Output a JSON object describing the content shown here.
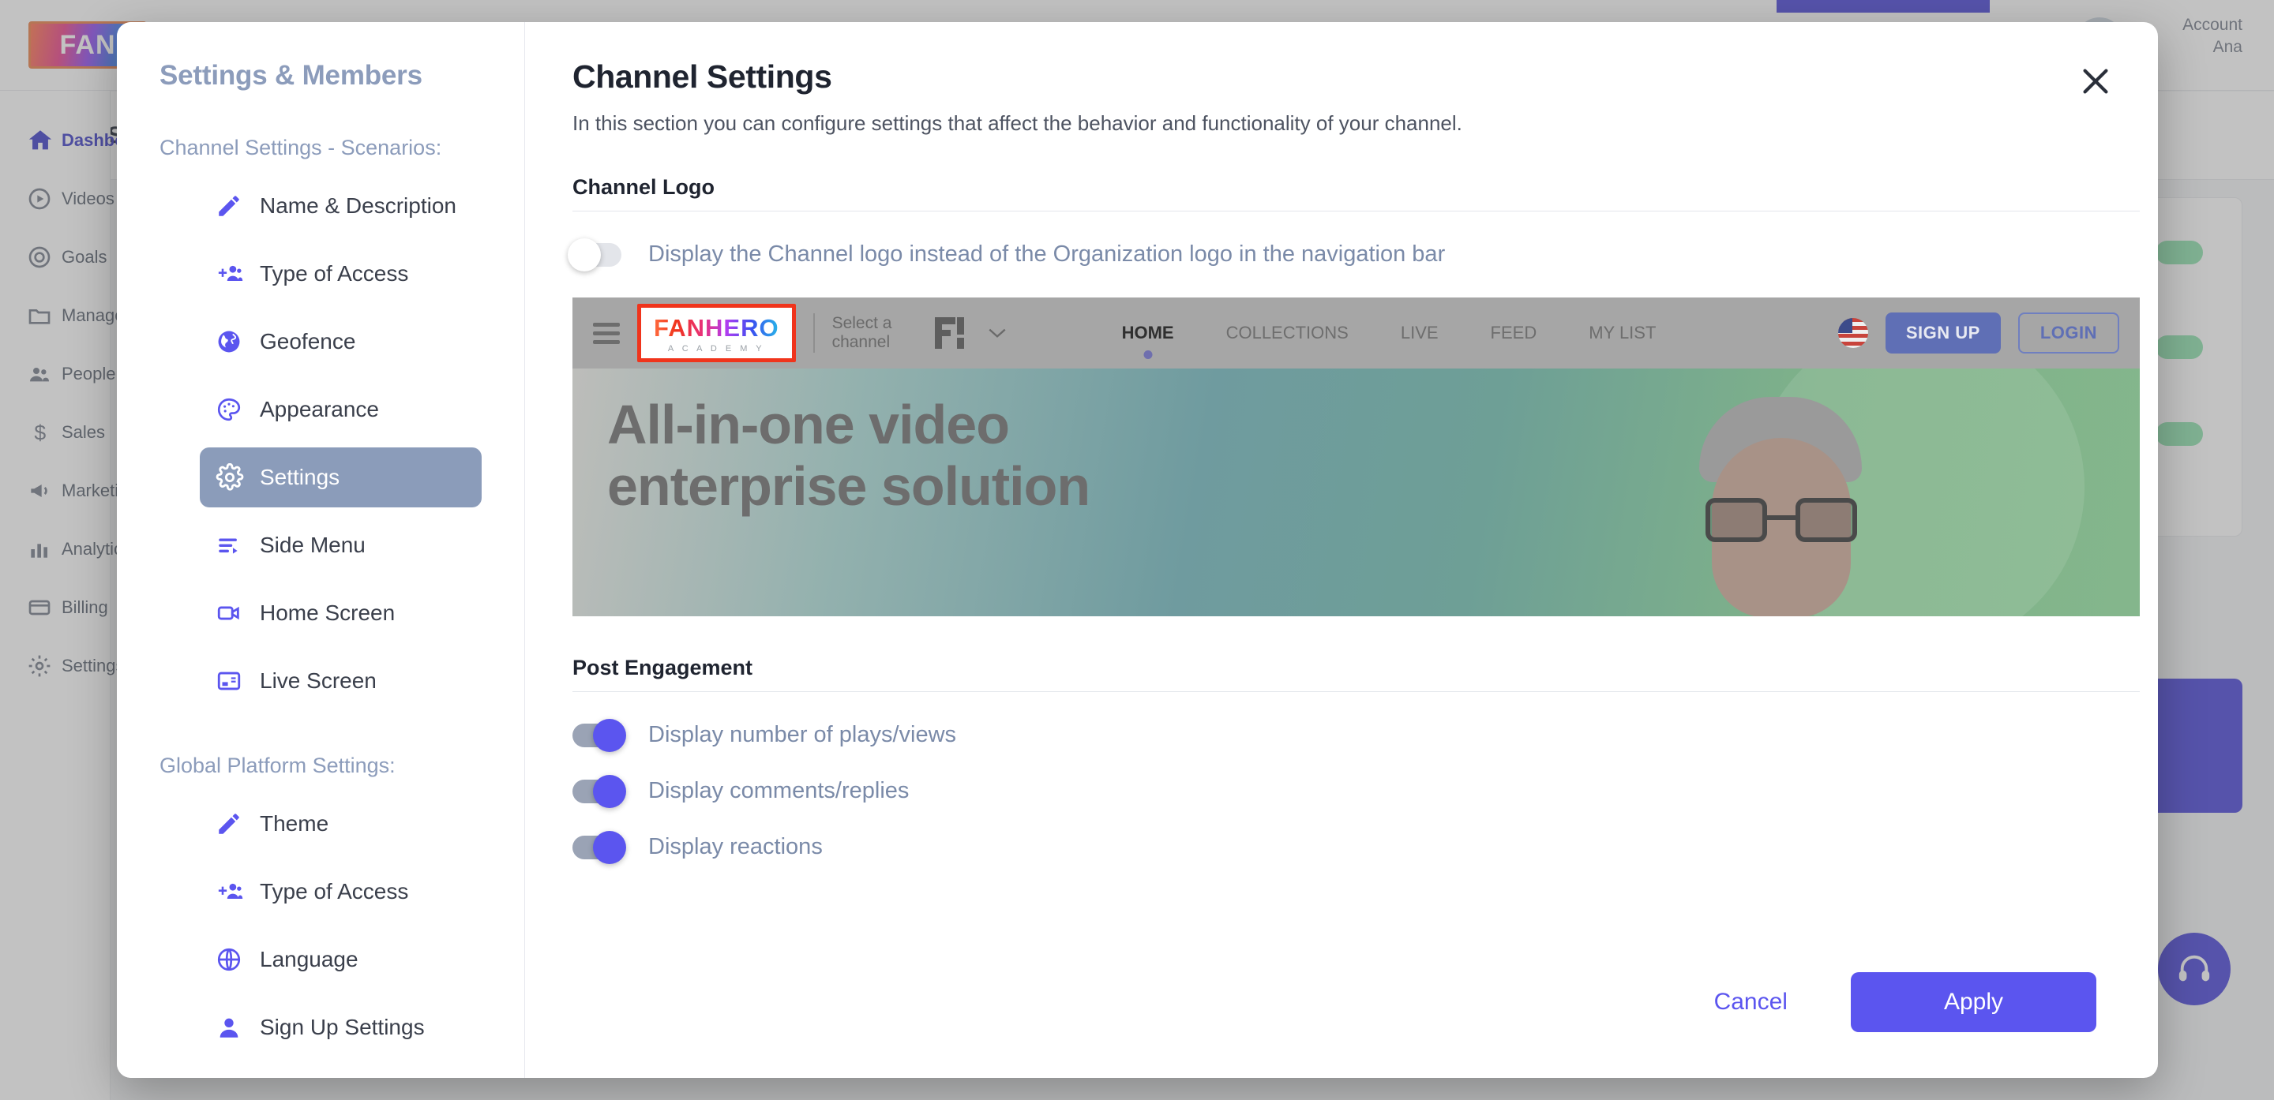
{
  "background": {
    "brand_logo_text": "FAN",
    "account_label_line1": "Account",
    "account_label_line2": "Ana",
    "channel_name": "S",
    "sidebar_items": [
      {
        "label": "Dashboard",
        "icon": "home-icon",
        "active": true
      },
      {
        "label": "Videos",
        "icon": "play-circle-icon",
        "active": false
      },
      {
        "label": "Goals",
        "icon": "target-icon",
        "active": false
      },
      {
        "label": "Manage",
        "icon": "folder-icon",
        "active": false
      },
      {
        "label": "People",
        "icon": "people-icon",
        "active": false
      },
      {
        "label": "Sales",
        "icon": "dollar-icon",
        "active": false
      },
      {
        "label": "Marketing",
        "icon": "megaphone-icon",
        "active": false
      },
      {
        "label": "Analytics",
        "icon": "chart-icon",
        "active": false
      },
      {
        "label": "Billing",
        "icon": "card-icon",
        "active": false
      },
      {
        "label": "Settings",
        "icon": "gear-icon",
        "active": false
      }
    ]
  },
  "modal": {
    "nav": {
      "title": "Settings & Members",
      "groups": [
        {
          "label": "Channel Settings - Scenarios:",
          "items": [
            {
              "label": "Name & Description",
              "icon": "pencil-icon",
              "active": false
            },
            {
              "label": "Type of Access",
              "icon": "add-person-icon",
              "active": false
            },
            {
              "label": "Geofence",
              "icon": "globe-icon",
              "active": false
            },
            {
              "label": "Appearance",
              "icon": "palette-icon",
              "active": false
            },
            {
              "label": "Settings",
              "icon": "gear-icon",
              "active": true
            },
            {
              "label": "Side Menu",
              "icon": "side-menu-icon",
              "active": false
            },
            {
              "label": "Home Screen",
              "icon": "video-camera-icon",
              "active": false
            },
            {
              "label": "Live Screen",
              "icon": "live-screen-icon",
              "active": false
            }
          ]
        },
        {
          "label": "Global Platform Settings:",
          "items": [
            {
              "label": "Theme",
              "icon": "pencil-icon",
              "active": false
            },
            {
              "label": "Type of Access",
              "icon": "add-person-icon",
              "active": false
            },
            {
              "label": "Language",
              "icon": "globe-icon",
              "active": false
            },
            {
              "label": "Sign Up Settings",
              "icon": "person-icon",
              "active": false
            }
          ]
        }
      ]
    },
    "header": {
      "title": "Channel Settings",
      "subtitle": "In this section you can configure settings that affect the behavior and functionality of your channel.",
      "close_icon": "close-icon"
    },
    "channel_logo": {
      "section_title": "Channel Logo",
      "toggle_label": "Display the Channel logo instead of the Organization logo in the navigation bar",
      "toggle_state": "off"
    },
    "preview": {
      "hamburger_icon": "hamburger-icon",
      "logo_main": "FANHERO",
      "logo_sub": "A C A D E M Y",
      "select_channel_label": "Select a channel",
      "brand_mark": "FH",
      "chevron_icon": "chevron-down-icon",
      "menu_items": [
        {
          "label": "HOME",
          "active": true
        },
        {
          "label": "COLLECTIONS",
          "active": false
        },
        {
          "label": "LIVE",
          "active": false
        },
        {
          "label": "FEED",
          "active": false
        },
        {
          "label": "MY LIST",
          "active": false
        }
      ],
      "flag_icon": "us-flag-icon",
      "signup_label": "SIGN UP",
      "login_label": "LOGIN",
      "hero_line1": "All-in-one video",
      "hero_line2": "enterprise solution"
    },
    "post_engagement": {
      "section_title": "Post Engagement",
      "toggles": [
        {
          "label": "Display number of plays/views",
          "state": "on"
        },
        {
          "label": "Display comments/replies",
          "state": "on"
        },
        {
          "label": "Display reactions",
          "state": "on"
        }
      ]
    },
    "footer": {
      "cancel_label": "Cancel",
      "apply_label": "Apply"
    }
  },
  "colors": {
    "accent_purple": "#5b55ef",
    "active_nav_bg": "#8b9cba",
    "muted_blue_text": "#7a8aa8",
    "logo_highlight_border": "#f0341c"
  }
}
